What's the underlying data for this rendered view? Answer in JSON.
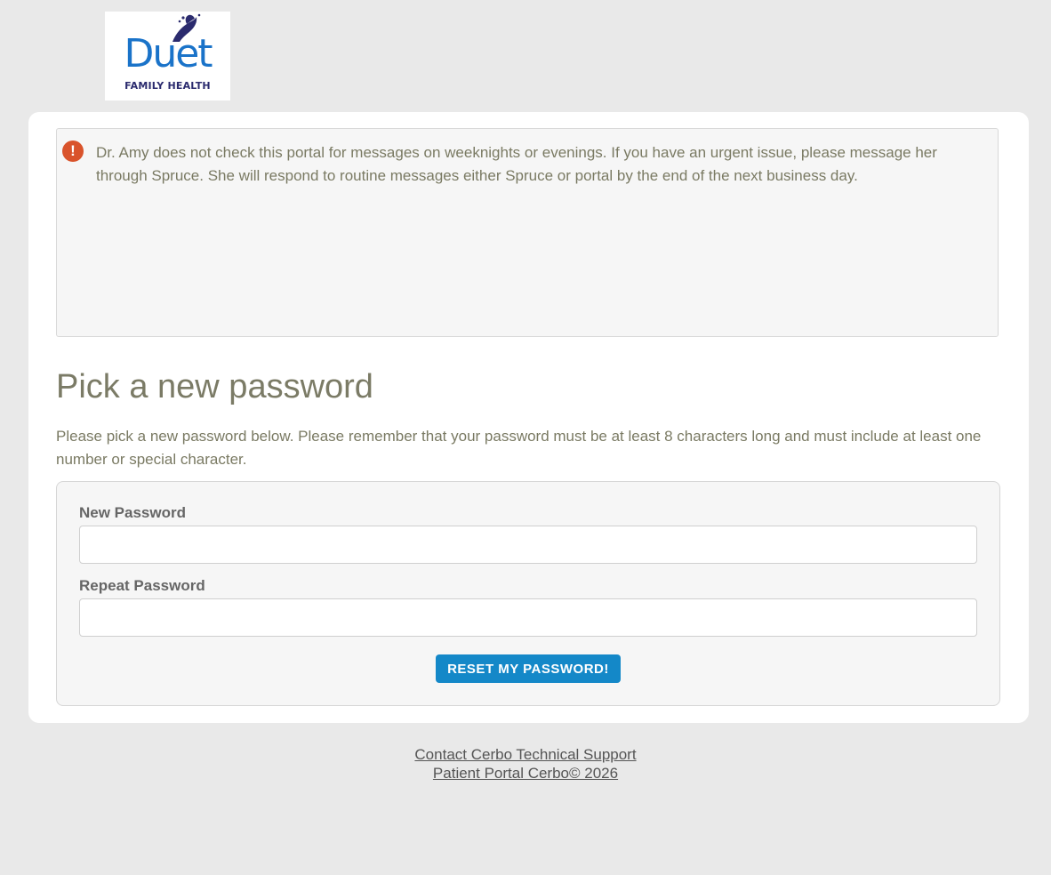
{
  "logo": {
    "word": "Duet",
    "sub": "FAMILY HEALTH",
    "brand_color": "#1a73c9",
    "sub_color": "#2b2b6e"
  },
  "notice": {
    "icon": "exclamation-circle-icon",
    "icon_color": "#d9532b",
    "text": "Dr. Amy does not check this portal for messages on weeknights or evenings.  If you have an urgent issue, please message her through Spruce.  She will respond to routine messages either Spruce or portal by the end of the next business day."
  },
  "page": {
    "title": "Pick a new password",
    "intro": "Please pick a new password below. Please remember that your password must be at least 8 characters long and must include at least one number or special character."
  },
  "form": {
    "new_password_label": "New Password",
    "new_password_value": "",
    "repeat_password_label": "Repeat Password",
    "repeat_password_value": "",
    "submit_label": "RESET MY PASSWORD!",
    "button_color": "#1488c8"
  },
  "footer": {
    "support_link": "Contact Cerbo Technical Support",
    "copyright_link": "Patient Portal Cerbo© 2026"
  }
}
